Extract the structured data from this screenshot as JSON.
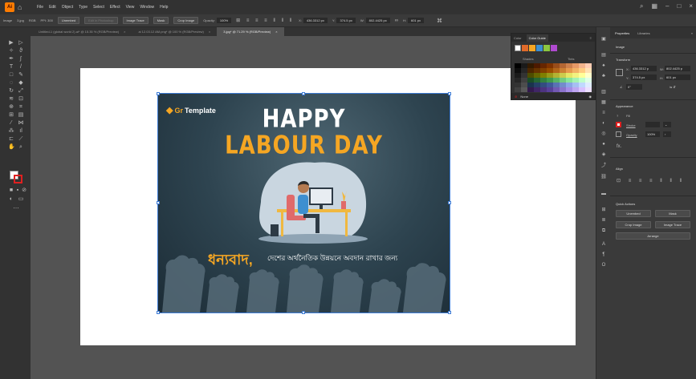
{
  "menubar": {
    "items": [
      "File",
      "Edit",
      "Object",
      "Type",
      "Select",
      "Effect",
      "View",
      "Window",
      "Help"
    ]
  },
  "control_bar": {
    "selection": "Image",
    "image_name": "3.jpg",
    "color_mode": "RGB",
    "ppi": "PPI: 300",
    "unembed": "Unembed",
    "edit_original": "Edit in Photoshop",
    "image_trace": "Image Trace",
    "mask": "Mask",
    "crop_image": "Crop Image",
    "opacity_label": "Opacity:",
    "opacity_value": "100%",
    "x_label": "X:",
    "x_value": "436.3312 px",
    "y_label": "Y:",
    "y_value": "374.5 px",
    "w_label": "W:",
    "w_value": "802.4425 px",
    "h_label": "H:",
    "h_value": "601 px"
  },
  "tabs": [
    {
      "label": "Untitled-1 (global world 2).ai* @ 15.35 % (RGB/Preview)",
      "active": false
    },
    {
      "label": "ai 12.03.12 AM.png* @ 100 % (RGB/Preview)",
      "active": false
    },
    {
      "label": "3.jpg* @ 71.29 % (RGB/Preview)",
      "active": true
    }
  ],
  "poster": {
    "brand": "Template",
    "brand_prefix": "Gr",
    "headline_1": "HAPPY",
    "headline_2": "LABOUR DAY",
    "bengali_title": "ধন্যবাদ,",
    "bengali_sub": "দেশের অর্থনৈতিক উন্নয়নে অবদান রাখার জন্য"
  },
  "color_panel": {
    "tab_color": "Color",
    "tab_guide": "Color Guide",
    "label_shades": "Shades",
    "label_tints": "Tints",
    "footer": "None",
    "swatches": [
      "#000000",
      "#1a1a1a",
      "#331a00",
      "#4d1a00",
      "#662600",
      "#803300",
      "#994d1a",
      "#b36633",
      "#cc804d",
      "#e69966",
      "#f2b38c",
      "#ffccb3",
      "#0d0d0d",
      "#262626",
      "#4d2600",
      "#663300",
      "#804000",
      "#994d00",
      "#b36619",
      "#cc8033",
      "#e6994d",
      "#f2b366",
      "#ffcc80",
      "#ffe0b3",
      "#1a1a1a",
      "#333333",
      "#4d4d00",
      "#666600",
      "#808000",
      "#999919",
      "#b3b333",
      "#cccc4d",
      "#e6e666",
      "#f2f280",
      "#ffff99",
      "#ffffcc",
      "#262626",
      "#404040",
      "#1a4d26",
      "#266633",
      "#338040",
      "#40994d",
      "#59b366",
      "#73cc80",
      "#8ce699",
      "#a6f2b3",
      "#c0ffcc",
      "#e0ffe6",
      "#333333",
      "#4d4d4d",
      "#1a334d",
      "#264066",
      "#334d80",
      "#405999",
      "#5973b3",
      "#738ccc",
      "#8ca6e6",
      "#a6bff2",
      "#c0d9ff",
      "#e0ecff",
      "#404040",
      "#595959",
      "#331a4d",
      "#402666",
      "#4d3380",
      "#594099",
      "#7359b3",
      "#8c73cc",
      "#a68ce6",
      "#bfa6f2",
      "#d9c0ff",
      "#ece0ff"
    ]
  },
  "properties": {
    "tab_properties": "Properties",
    "tab_libraries": "Libraries",
    "selection_label": "Image",
    "transform_title": "Transform",
    "x_label": "X:",
    "x_value": "436.3312 p",
    "w_label": "W:",
    "w_value": "802.4425 p",
    "y_label": "Y:",
    "y_value": "374.5 px",
    "h_label": "H:",
    "h_value": "601 px",
    "angle_value": "0°",
    "appearance_title": "Appearance",
    "fill_label": "Fill",
    "stroke_label": "Stroke",
    "opacity_label": "Opacity",
    "opacity_value": "100%",
    "fx_label": "fx.",
    "align_title": "Align",
    "quick_actions_title": "Quick Actions",
    "btn_unembed": "Unembed",
    "btn_mask": "Mask",
    "btn_crop": "Crop Image",
    "btn_trace": "Image Trace",
    "btn_arrange": "Arrange"
  },
  "colors": {
    "accent": "#f5a623",
    "selection": "#3d7bd5"
  }
}
